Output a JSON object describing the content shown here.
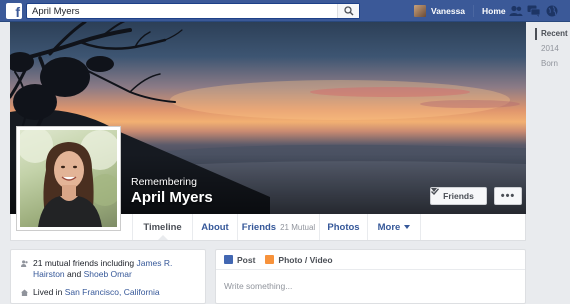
{
  "topbar": {
    "logo": "f",
    "search_value": "April Myers",
    "user_name": "Vanessa",
    "home_label": "Home",
    "icons": [
      "friend-requests-icon",
      "messages-icon",
      "notifications-globe-icon"
    ],
    "accent_color": "#3b5998"
  },
  "profile": {
    "remembering_label": "Remembering",
    "name": "April Myers",
    "friends_button_label": "Friends",
    "more_button_label": "•••"
  },
  "tabs": [
    {
      "label": "Timeline"
    },
    {
      "label": "About"
    },
    {
      "label": "Friends",
      "count": "21 Mutual"
    },
    {
      "label": "Photos"
    },
    {
      "label": "More"
    }
  ],
  "scrubber": [
    "Recent",
    "2014",
    "Born"
  ],
  "intro": {
    "mutual_prefix": "21 mutual friends including",
    "mutual_friend_1": "James R. Hairston",
    "mutual_and": "and",
    "mutual_friend_2": "Shoeb Omar",
    "lived_prefix": "Lived in",
    "lived_place": "San Francisco, California"
  },
  "composer": {
    "post_tab": "Post",
    "photo_tab": "Photo / Video",
    "placeholder": "Write something..."
  }
}
